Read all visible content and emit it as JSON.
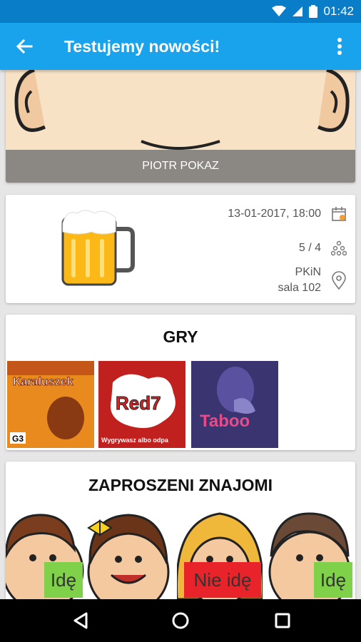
{
  "status": {
    "time": "01:42"
  },
  "appbar": {
    "title": "Testujemy nowości!"
  },
  "organizer": {
    "name": "PIOTR POKAZ"
  },
  "details": {
    "datetime": "13-01-2017, 18:00",
    "participants": "5 / 4",
    "place_line1": "PKiN",
    "place_line2": "sala 102"
  },
  "games": {
    "heading": "GRY",
    "items": [
      {
        "title": "Karaluszek",
        "subtitle": "G3"
      },
      {
        "title": "Red7",
        "subtitle": "Wygrywasz albo odpa"
      },
      {
        "title": "Taboo",
        "subtitle": ""
      }
    ]
  },
  "friends": {
    "heading": "ZAPROSZENI ZNAJOMI",
    "items": [
      {
        "status": "Idę",
        "status_color": "#7fd14a"
      },
      {
        "status": "",
        "status_color": ""
      },
      {
        "status": "Nie idę",
        "status_color": "#e8242a"
      },
      {
        "status": "Idę",
        "status_color": "#7fd14a"
      }
    ]
  },
  "colors": {
    "statusbar": "#0a7dc8",
    "appbar": "#1aa3ed",
    "accept": "#7fd14a",
    "decline": "#e8242a"
  }
}
